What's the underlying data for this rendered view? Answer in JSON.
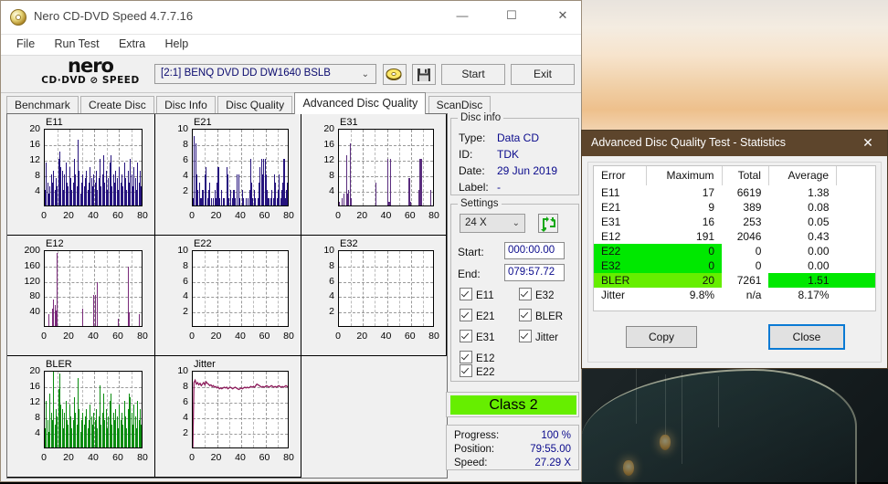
{
  "window": {
    "title": "Nero CD-DVD Speed 4.7.7.16",
    "icon": "disc-icon",
    "minimize": "—",
    "maximize": "☐",
    "close": "✕"
  },
  "menu": [
    "File",
    "Run Test",
    "Extra",
    "Help"
  ],
  "toolbar": {
    "logo_line1": "nero",
    "logo_line2": "CD·DVD ⊘ SPEED",
    "drive": "[2:1]   BENQ DVD DD DW1640 BSLB",
    "drive_chevron": "⌄",
    "eject_icon": "eject-disc-icon",
    "save_icon": "floppy-save-icon",
    "start_label": "Start",
    "exit_label": "Exit"
  },
  "tabs": [
    {
      "label": "Benchmark",
      "active": false
    },
    {
      "label": "Create Disc",
      "active": false
    },
    {
      "label": "Disc Info",
      "active": false
    },
    {
      "label": "Disc Quality",
      "active": false
    },
    {
      "label": "Advanced Disc Quality",
      "active": true
    },
    {
      "label": "ScanDisc",
      "active": false
    }
  ],
  "disc_info": {
    "group_title": "Disc info",
    "rows": [
      {
        "label": "Type:",
        "value": "Data CD"
      },
      {
        "label": "ID:",
        "value": "TDK"
      },
      {
        "label": "Date:",
        "value": "29 Jun 2019"
      },
      {
        "label": "Label:",
        "value": "-"
      }
    ]
  },
  "settings": {
    "group_title": "Settings",
    "speed": "24 X",
    "speed_chevron": "⌄",
    "refresh_icon": "refresh-icon",
    "start_label": "Start:",
    "start_value": "000:00.00",
    "end_label": "End:",
    "end_value": "079:57.72",
    "checkboxes_left": [
      "E11",
      "E21",
      "E31",
      "E12",
      "E22"
    ],
    "checkboxes_right": [
      "E32",
      "BLER",
      "Jitter"
    ]
  },
  "quality": {
    "class_label": "Class 2",
    "class_color": "#66ee00",
    "progress_label": "Progress:",
    "progress_value": "100 %",
    "position_label": "Position:",
    "position_value": "79:55.00",
    "speed_label": "Speed:",
    "speed_value": "27.29 X"
  },
  "statistics_dialog": {
    "title": "Advanced Disc Quality Test - Statistics",
    "close_icon": "✕",
    "columns": [
      "Error",
      "Maximum",
      "Total",
      "Average"
    ],
    "rows": [
      {
        "error": "E11",
        "maximum": "17",
        "total": "6619",
        "average": "1.38",
        "highlight": "none"
      },
      {
        "error": "E21",
        "maximum": "9",
        "total": "389",
        "average": "0.08",
        "highlight": "none"
      },
      {
        "error": "E31",
        "maximum": "16",
        "total": "253",
        "average": "0.05",
        "highlight": "none"
      },
      {
        "error": "E12",
        "maximum": "191",
        "total": "2046",
        "average": "0.43",
        "highlight": "none"
      },
      {
        "error": "E22",
        "maximum": "0",
        "total": "0",
        "average": "0.00",
        "highlight": "left"
      },
      {
        "error": "E32",
        "maximum": "0",
        "total": "0",
        "average": "0.00",
        "highlight": "left"
      },
      {
        "error": "BLER",
        "maximum": "20",
        "total": "7261",
        "average": "1.51",
        "highlight": "left-avg"
      },
      {
        "error": "Jitter",
        "maximum": "9.8%",
        "total": "n/a",
        "average": "8.17%",
        "highlight": "none"
      }
    ],
    "highlight_color": "#00e800",
    "highlight_color_alt": "#66ee00",
    "copy_label": "Copy",
    "close_label": "Close"
  },
  "chart_data": [
    {
      "type": "bar",
      "title": "E11",
      "xlabel": "",
      "ylabel": "",
      "color": "#26147e",
      "ylim": [
        0,
        20
      ],
      "xlim": [
        0,
        80
      ],
      "yticks": [
        4,
        8,
        12,
        16,
        20
      ],
      "xticks": [
        0,
        20,
        40,
        60,
        80
      ],
      "values": [
        4,
        11,
        6,
        3,
        5,
        8,
        6,
        9,
        4,
        7,
        5,
        12,
        14,
        10,
        9,
        4,
        8,
        11,
        6,
        5,
        10,
        7,
        4,
        6,
        12,
        8,
        5,
        17,
        9,
        3,
        6,
        8,
        5,
        7,
        9,
        4,
        6,
        10,
        7,
        5,
        8,
        6,
        9,
        4,
        7,
        12,
        5,
        8,
        13,
        6,
        9,
        4,
        7,
        11,
        13,
        5,
        8,
        6,
        9,
        7,
        4,
        10,
        6,
        8,
        5,
        11,
        7,
        4,
        9,
        6,
        12,
        8,
        5,
        10,
        7,
        4,
        11,
        6,
        9,
        5,
        3
      ]
    },
    {
      "type": "bar",
      "title": "E21",
      "xlabel": "",
      "ylabel": "",
      "color": "#26147e",
      "ylim": [
        0,
        10
      ],
      "xlim": [
        0,
        80
      ],
      "yticks": [
        2,
        4,
        6,
        8,
        10
      ],
      "xticks": [
        0,
        20,
        40,
        60,
        80
      ],
      "values": [
        1,
        9,
        8,
        4,
        2,
        3,
        1,
        1,
        2,
        0,
        4,
        5,
        1,
        2,
        3,
        1,
        0,
        1,
        2,
        1,
        3,
        5,
        1,
        0,
        2,
        1,
        1,
        0,
        5,
        4,
        1,
        2,
        0,
        1,
        2,
        1,
        0,
        4,
        4,
        1,
        0,
        2,
        1,
        0,
        1,
        0,
        1,
        2,
        6,
        3,
        1,
        2,
        1,
        0,
        1,
        3,
        5,
        6,
        4,
        6,
        6,
        4,
        2,
        1,
        0,
        1,
        2,
        1,
        4,
        3,
        1,
        2,
        4,
        1,
        2,
        3,
        6,
        1,
        2,
        3,
        3
      ]
    },
    {
      "type": "bar",
      "title": "E31",
      "xlabel": "",
      "ylabel": "",
      "color": "#5a2d7e",
      "ylim": [
        0,
        20
      ],
      "xlim": [
        0,
        80
      ],
      "yticks": [
        4,
        8,
        12,
        16,
        20
      ],
      "xticks": [
        0,
        20,
        40,
        60,
        80
      ],
      "values": [
        1,
        0,
        2,
        0,
        3,
        0,
        13,
        3,
        4,
        16,
        2,
        0,
        0,
        0,
        0,
        0,
        0,
        0,
        0,
        0,
        0,
        0,
        0,
        0,
        0,
        0,
        0,
        0,
        0,
        0,
        0,
        6,
        0,
        0,
        0,
        0,
        0,
        0,
        0,
        0,
        0,
        12,
        1,
        12,
        0,
        0,
        0,
        0,
        0,
        0,
        0,
        0,
        0,
        0,
        0,
        0,
        0,
        0,
        0,
        7,
        1,
        0,
        0,
        0,
        0,
        0,
        0,
        4,
        12,
        12,
        0,
        0,
        0,
        0,
        0,
        0,
        0,
        4,
        0,
        0,
        3
      ]
    },
    {
      "type": "bar",
      "title": "E12",
      "xlabel": "",
      "ylabel": "",
      "color": "#7a2a7a",
      "ylim": [
        0,
        200
      ],
      "xlim": [
        0,
        80
      ],
      "yticks": [
        40,
        80,
        120,
        160,
        200
      ],
      "xticks": [
        0,
        20,
        40,
        60,
        80
      ],
      "values": [
        0,
        0,
        0,
        30,
        0,
        0,
        45,
        70,
        55,
        40,
        190,
        0,
        0,
        0,
        0,
        0,
        0,
        0,
        0,
        0,
        0,
        0,
        0,
        0,
        0,
        0,
        0,
        0,
        0,
        0,
        0,
        45,
        0,
        0,
        0,
        0,
        0,
        0,
        0,
        0,
        80,
        82,
        0,
        115,
        0,
        0,
        0,
        0,
        0,
        0,
        0,
        0,
        0,
        0,
        0,
        0,
        0,
        0,
        0,
        0,
        18,
        0,
        0,
        0,
        0,
        0,
        0,
        0,
        155,
        35,
        0,
        0,
        0,
        0,
        0,
        0,
        0,
        30,
        0,
        0,
        150
      ]
    },
    {
      "type": "bar",
      "title": "E22",
      "xlabel": "",
      "ylabel": "",
      "color": "#7a2a7a",
      "ylim": [
        0,
        10
      ],
      "xlim": [
        0,
        80
      ],
      "yticks": [
        2,
        4,
        6,
        8,
        10
      ],
      "xticks": [
        0,
        20,
        40,
        60,
        80
      ],
      "values": []
    },
    {
      "type": "bar",
      "title": "E32",
      "xlabel": "",
      "ylabel": "",
      "color": "#7a2a7a",
      "ylim": [
        0,
        10
      ],
      "xlim": [
        0,
        80
      ],
      "yticks": [
        2,
        4,
        6,
        8,
        10
      ],
      "xticks": [
        0,
        20,
        40,
        60,
        80
      ],
      "values": []
    },
    {
      "type": "bar",
      "title": "BLER",
      "xlabel": "",
      "ylabel": "",
      "color": "#0a8c10",
      "ylim": [
        0,
        20
      ],
      "xlim": [
        0,
        80
      ],
      "yticks": [
        4,
        8,
        12,
        16,
        20
      ],
      "xticks": [
        0,
        20,
        40,
        60,
        80
      ],
      "values": [
        5,
        12,
        7,
        4,
        14,
        9,
        7,
        20,
        6,
        10,
        8,
        15,
        19,
        11,
        10,
        5,
        9,
        12,
        7,
        6,
        11,
        8,
        5,
        7,
        13,
        9,
        6,
        18,
        10,
        4,
        7,
        9,
        6,
        8,
        10,
        5,
        7,
        11,
        8,
        6,
        9,
        7,
        10,
        5,
        8,
        16,
        6,
        9,
        14,
        7,
        10,
        5,
        8,
        12,
        14,
        6,
        9,
        7,
        10,
        8,
        5,
        11,
        7,
        9,
        6,
        12,
        8,
        5,
        10,
        14,
        13,
        9,
        6,
        11,
        8,
        5,
        12,
        7,
        10,
        6,
        4
      ]
    },
    {
      "type": "line",
      "title": "Jitter",
      "xlabel": "",
      "ylabel": "",
      "color": "#8c1a5a",
      "ylim": [
        0,
        10
      ],
      "xlim": [
        0,
        80
      ],
      "yticks": [
        2,
        4,
        6,
        8,
        10
      ],
      "xticks": [
        0,
        20,
        40,
        60,
        80
      ],
      "values": [
        0,
        8.6,
        8.9,
        8.4,
        8.6,
        8.3,
        8.5,
        8.2,
        8.4,
        8.6,
        8.3,
        8.7,
        8.5,
        8.4,
        8.2,
        8.3,
        8.1,
        8.2,
        8.0,
        8.1,
        7.9,
        8.0,
        7.8,
        7.9,
        7.8,
        7.9,
        8.0,
        7.9,
        8.0,
        7.8,
        7.9,
        8.0,
        7.9,
        7.8,
        7.9,
        8.0,
        7.9,
        7.8,
        7.7,
        7.8,
        7.9,
        7.8,
        7.9,
        8.0,
        7.9,
        8.0,
        7.9,
        8.0,
        8.1,
        8.0,
        8.1,
        8.0,
        8.2,
        8.4,
        8.3,
        8.2,
        8.1,
        8.0,
        8.1,
        8.0,
        8.1,
        8.2,
        8.1,
        8.0,
        8.1,
        8.2,
        8.1,
        8.0,
        8.1,
        8.0,
        8.1,
        8.2,
        8.1,
        8.0,
        8.1,
        8.0,
        8.1,
        8.2,
        8.1,
        8.0,
        8.3
      ]
    }
  ]
}
